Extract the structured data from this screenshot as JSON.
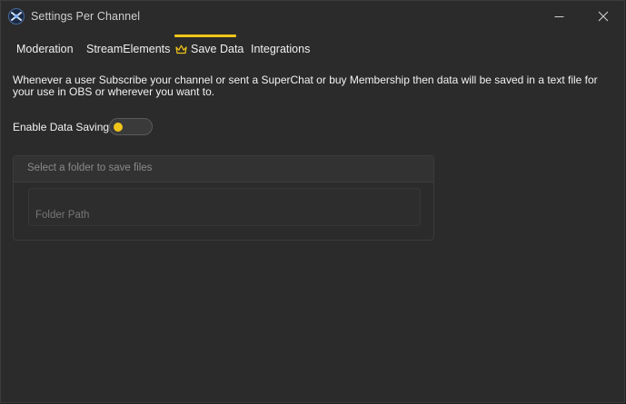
{
  "window": {
    "title": "Settings Per Channel",
    "icon": "app-logo-icon"
  },
  "tabs": [
    {
      "label": "Moderation",
      "active": false
    },
    {
      "label": "StreamElements",
      "active": false
    },
    {
      "label": "Save Data",
      "active": true,
      "icon": "crown-icon"
    },
    {
      "label": "Integrations",
      "active": false
    }
  ],
  "main": {
    "description": "Whenever a user Subscribe your channel or sent a SuperChat or buy Membership then data will be saved in a text file for your use in OBS or wherever you want to.",
    "enable_label": "Enable Data Saving",
    "enable_toggle": {
      "on": false
    },
    "folder_card": {
      "header": "Select a folder to save files",
      "input_placeholder": "Folder Path"
    }
  },
  "colors": {
    "accent": "#f0c419",
    "background": "#2b2b2b",
    "text": "#f2f2f2",
    "muted_text": "#8a8a8a"
  }
}
